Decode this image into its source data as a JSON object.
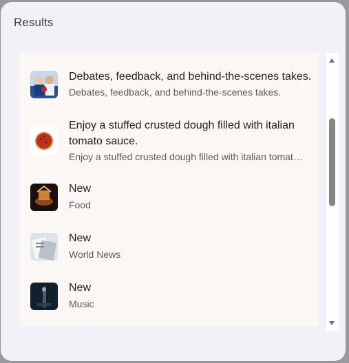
{
  "dialog": {
    "title": "Results"
  },
  "items": [
    {
      "title": "Debates, feedback, and behind-the-scenes takes.",
      "subtitle": "Debates, feedback, and behind-the-scenes takes.",
      "thumb": "people-thumbnail"
    },
    {
      "title": "Enjoy a stuffed crusted dough filled with italian tomato sauce.",
      "subtitle": "Enjoy a stuffed crusted dough filled with italian tomat…",
      "thumb": "pizza-thumbnail"
    },
    {
      "title": "New",
      "subtitle": "Food",
      "thumb": "food-thumbnail"
    },
    {
      "title": "New",
      "subtitle": "World News",
      "thumb": "news-thumbnail"
    },
    {
      "title": "New",
      "subtitle": "Music",
      "thumb": "music-thumbnail"
    }
  ],
  "scroll": {
    "position": 0.3
  }
}
